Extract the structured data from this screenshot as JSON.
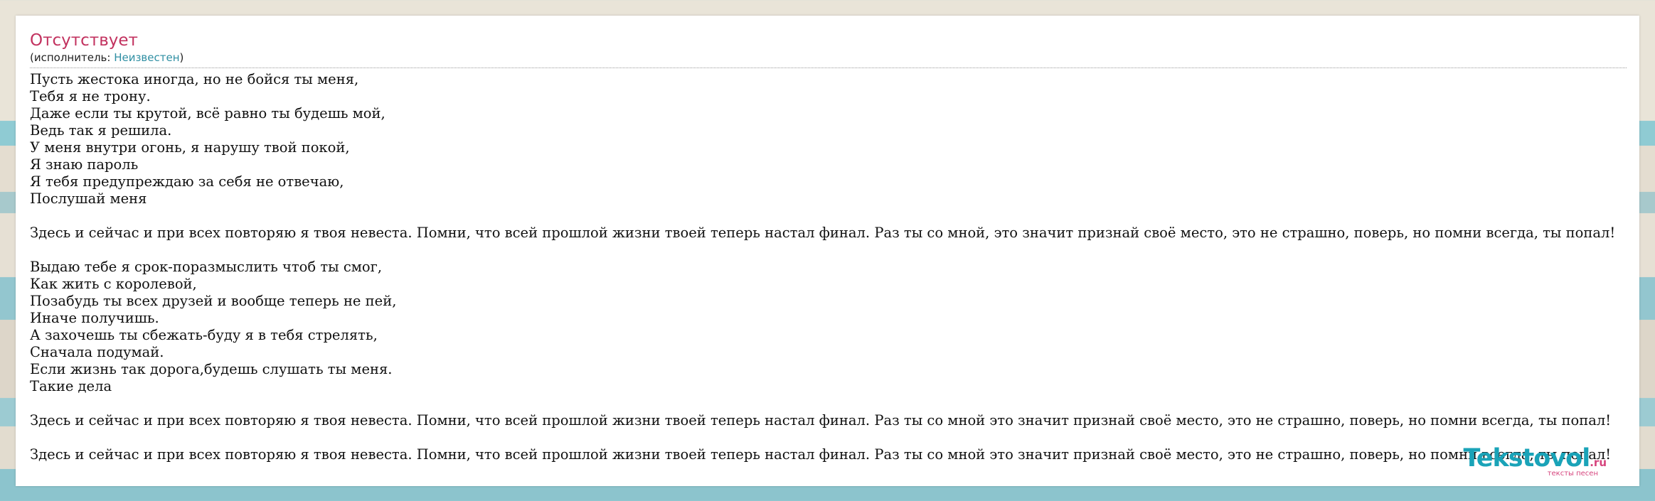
{
  "song": {
    "title": "Отсутствует",
    "artist_prefix": "(исполнитель: ",
    "artist_name": "Неизвестен",
    "artist_suffix": ")"
  },
  "lyrics": [
    "Пусть жестока иногда, но не бойся ты меня,",
    "Тебя я не трону.",
    "Даже если ты крутой, всё равно ты будешь мой,",
    "Ведь так я решила.",
    "У меня внутри огонь, я нарушу твой покой,",
    "Я знаю пароль",
    "Я тебя предупреждаю за себя не отвечаю,",
    "Послушай меня",
    "",
    "Здесь и сейчас и при всех повторяю я твоя невеста. Помни, что всей прошлой жизни твоей теперь настал финал. Раз ты со мной, это значит признай своё место, это не страшно, поверь, но помни всегда, ты попал!",
    "",
    "Выдаю тебе я срок-поразмыслить чтоб ты смог,",
    "Как жить с королевой,",
    "Позабудь ты всех друзей и вообще теперь не пей,",
    "Иначе получишь.",
    "А захочешь ты сбежать-буду я в тебя стрелять,",
    "Сначала подумай.",
    "Если жизнь так дорога,будешь слушать ты меня.",
    "Такие дела",
    "",
    "Здесь и сейчас и при всех повторяю я твоя невеста. Помни, что всей прошлой жизни твоей теперь настал финал. Раз ты со мной это значит признай своё место, это не страшно, поверь, но помни всегда, ты попал!",
    "",
    "Здесь и сейчас и при всех повторяю я твоя невеста. Помни, что всей прошлой жизни твоей теперь настал финал. Раз ты со мной это значит признай своё место, это не страшно, поверь, но помни всегда, ты попал!"
  ],
  "logo": {
    "name": "Tekstovol",
    "tld": ".ru",
    "tagline": "тексты песен"
  }
}
